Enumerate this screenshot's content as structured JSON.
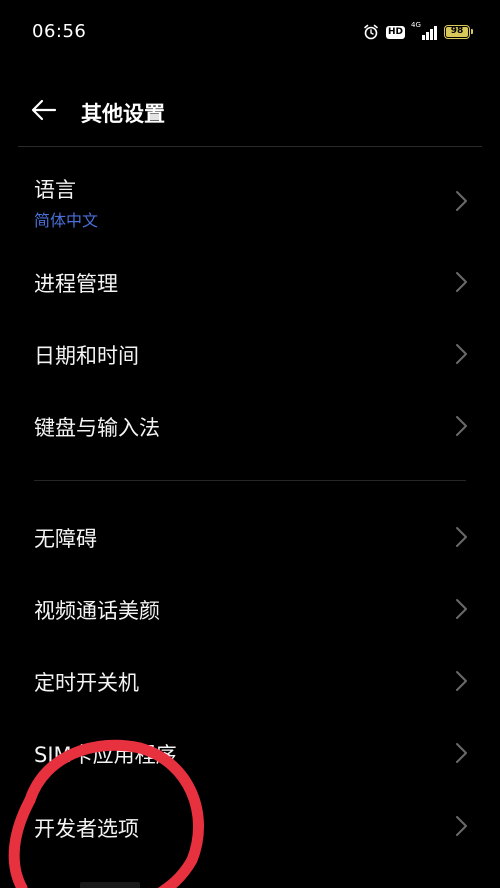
{
  "status_bar": {
    "time": "06:56",
    "hd": "HD",
    "network": "4G",
    "battery": "98",
    "battery_level": 0.98
  },
  "header": {
    "title": "其他设置"
  },
  "items": [
    {
      "label": "语言",
      "subtitle": "简体中文"
    },
    {
      "label": "进程管理"
    },
    {
      "label": "日期和时间"
    },
    {
      "label": "键盘与输入法"
    },
    {
      "label": "无障碍"
    },
    {
      "label": "视频通话美颜"
    },
    {
      "label": "定时开关机"
    },
    {
      "label": "SIM卡应用程序"
    },
    {
      "label": "开发者选项"
    }
  ],
  "colors": {
    "subtitle": "#4a6fd8",
    "annotation": "#e8313f",
    "battery": "#d8c75a"
  }
}
